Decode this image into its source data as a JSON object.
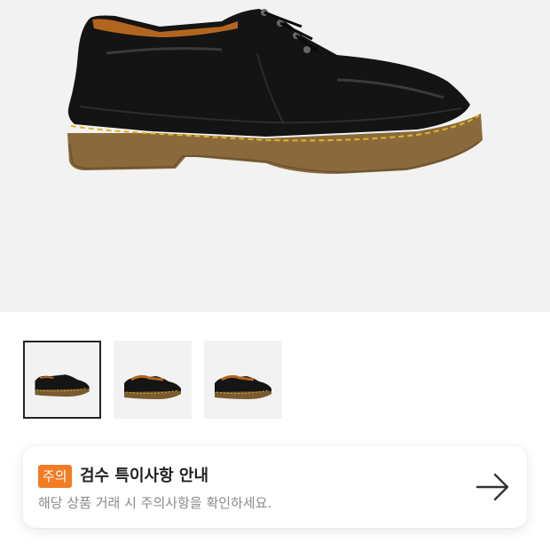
{
  "product": {
    "main_image_icon": "black-leather-derby-shoe",
    "thumbnails": [
      {
        "icon": "black-leather-derby-shoe",
        "selected": true
      },
      {
        "icon": "black-leather-derby-shoe",
        "selected": false
      },
      {
        "icon": "black-leather-derby-shoe",
        "selected": false
      }
    ]
  },
  "notice": {
    "badge": "주의",
    "title": "검수 특이사항 안내",
    "subtitle": "해당 상품 거래 시 주의사항을 확인하세요.",
    "arrow_icon": "arrow-right-icon"
  },
  "colors": {
    "badge_bg": "#f27b24",
    "hero_bg": "#f2f2f2",
    "title_text": "#222222",
    "sub_text": "#8a8a8a"
  }
}
